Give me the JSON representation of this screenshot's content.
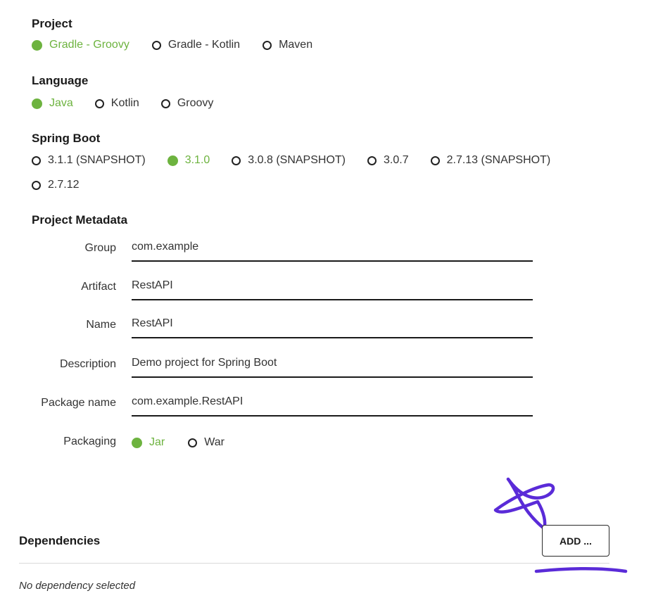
{
  "project": {
    "heading": "Project",
    "options": [
      {
        "label": "Gradle - Groovy",
        "selected": true
      },
      {
        "label": "Gradle - Kotlin",
        "selected": false
      },
      {
        "label": "Maven",
        "selected": false
      }
    ]
  },
  "language": {
    "heading": "Language",
    "options": [
      {
        "label": "Java",
        "selected": true
      },
      {
        "label": "Kotlin",
        "selected": false
      },
      {
        "label": "Groovy",
        "selected": false
      }
    ]
  },
  "spring_boot": {
    "heading": "Spring Boot",
    "options": [
      {
        "label": "3.1.1 (SNAPSHOT)",
        "selected": false
      },
      {
        "label": "3.1.0",
        "selected": true
      },
      {
        "label": "3.0.8 (SNAPSHOT)",
        "selected": false
      },
      {
        "label": "3.0.7",
        "selected": false
      },
      {
        "label": "2.7.13 (SNAPSHOT)",
        "selected": false
      },
      {
        "label": "2.7.12",
        "selected": false
      }
    ]
  },
  "metadata": {
    "heading": "Project Metadata",
    "fields": [
      {
        "label": "Group",
        "value": "com.example"
      },
      {
        "label": "Artifact",
        "value": "RestAPI"
      },
      {
        "label": "Name",
        "value": "RestAPI"
      },
      {
        "label": "Description",
        "value": "Demo project for Spring Boot"
      },
      {
        "label": "Package name",
        "value": "com.example.RestAPI"
      }
    ],
    "packaging": {
      "label": "Packaging",
      "options": [
        {
          "label": "Jar",
          "selected": true
        },
        {
          "label": "War",
          "selected": false
        }
      ]
    }
  },
  "dependencies": {
    "heading": "Dependencies",
    "add_label": "ADD ...",
    "empty_text": "No dependency selected"
  },
  "colors": {
    "accent": "#6db33f",
    "annotation": "#5a2bd8",
    "text": "#1b1b1b"
  }
}
